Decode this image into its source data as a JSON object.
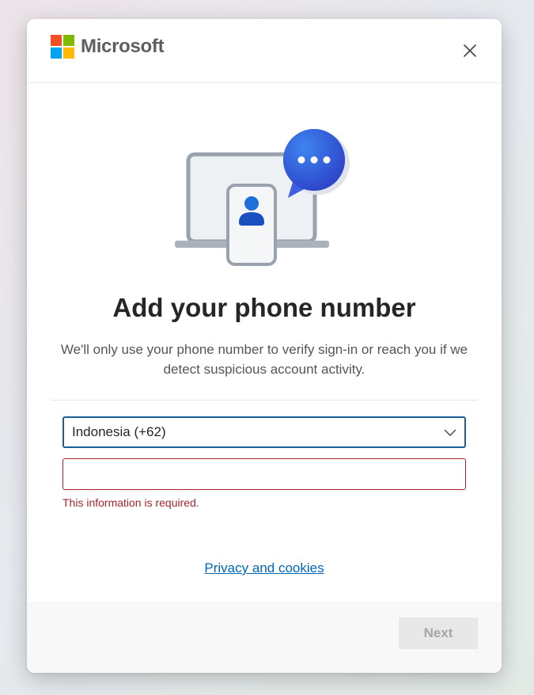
{
  "brand": {
    "name": "Microsoft",
    "logo_colors": [
      "#f25022",
      "#7fba00",
      "#00a4ef",
      "#ffb900"
    ]
  },
  "header": {
    "close_icon": "close-icon"
  },
  "illustration": {
    "name": "laptop-phone-chat-illustration"
  },
  "main": {
    "title": "Add your phone number",
    "description": "We'll only use your phone number to verify sign-in or reach you if we detect suspicious account activity.",
    "country_select": {
      "value": "Indonesia (+62)",
      "icon": "chevron-down-icon"
    },
    "phone_input": {
      "value": "",
      "placeholder": ""
    },
    "error_text": "This information is required.",
    "privacy_link": "Privacy and cookies"
  },
  "footer": {
    "next_label": "Next"
  },
  "colors": {
    "accent": "#0067b8",
    "focus_border": "#1a5e9a",
    "error": "#a4262c",
    "disabled_bg": "#e8e8e8",
    "disabled_text": "#a6a6a6"
  }
}
